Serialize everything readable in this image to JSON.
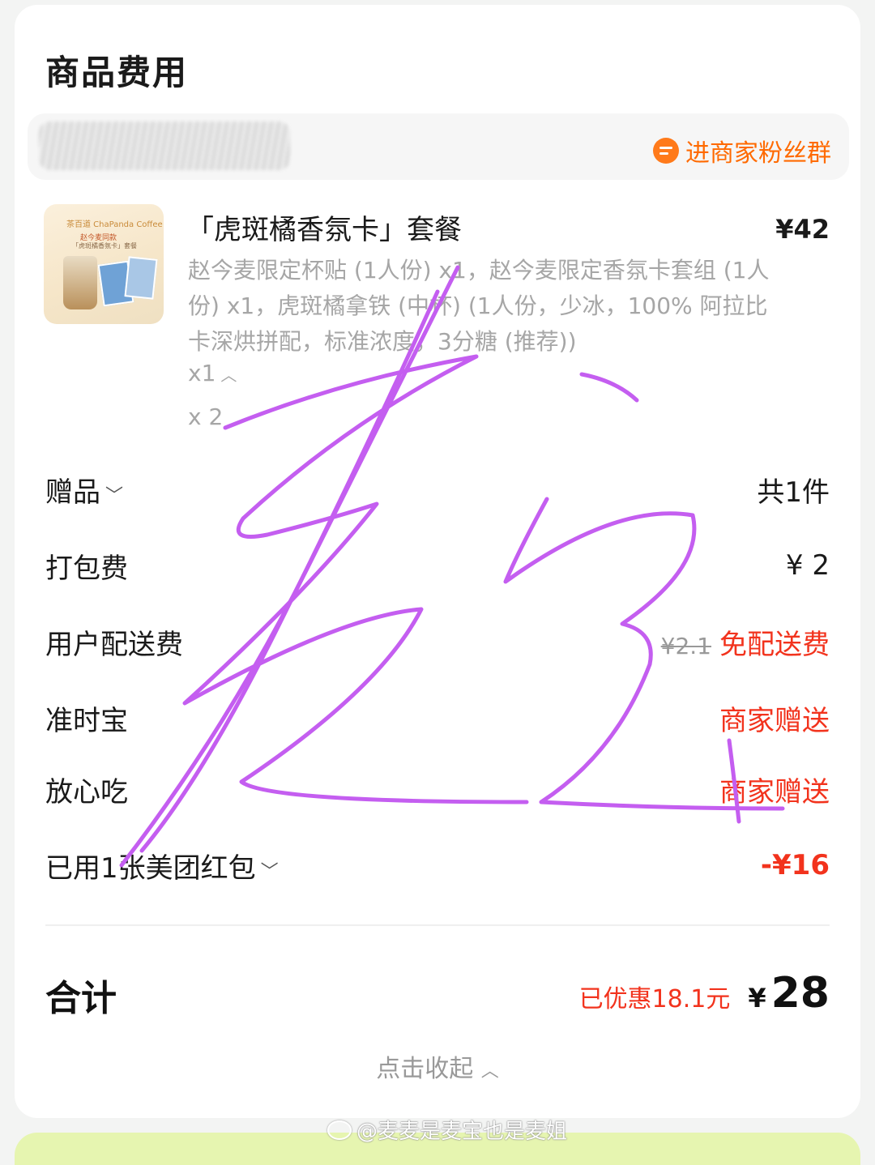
{
  "section_title": "商品费用",
  "store": {
    "fans_group": "进商家粉丝群",
    "fans_icon": "chat-icon"
  },
  "product": {
    "thumb_brand": "茶百道 ChaPanda Coffee",
    "thumb_line1": "赵今麦同款",
    "thumb_line2": "「虎斑橘香氛卡」套餐",
    "name": "「虎斑橘香氛卡」套餐",
    "price": "¥42",
    "desc": "赵今麦限定杯贴 (1人份) x1，赵今麦限定香氛卡套组 (1人份) x1，虎斑橘拿铁 (中杯) (1人份，少冰，100% 阿拉比卡深烘拼配，标准浓度，3分糖 (推荐))",
    "desc_count": "x1",
    "qty": "x 2"
  },
  "fees": [
    {
      "label": "赠品",
      "value": "共1件",
      "has_chevron": true
    },
    {
      "label": "打包费",
      "value": "¥ 2"
    },
    {
      "label": "用户配送费",
      "original": "¥2.1",
      "value": "免配送费"
    },
    {
      "label": "准时宝",
      "value": "商家赠送"
    },
    {
      "label": "放心吃",
      "value": "商家赠送"
    },
    {
      "label": "已用1张美团红包",
      "value": "-¥16",
      "has_chevron": true
    }
  ],
  "total": {
    "label": "合计",
    "saved": "已优惠18.1元",
    "currency": "¥",
    "amount": "28"
  },
  "collapse_label": "点击收起",
  "watermark": "@麦麦是麦宝也是麦姐",
  "colors": {
    "accent_red": "#f2331d",
    "orange": "#ff6a00",
    "scribble": "#c45ef0"
  }
}
